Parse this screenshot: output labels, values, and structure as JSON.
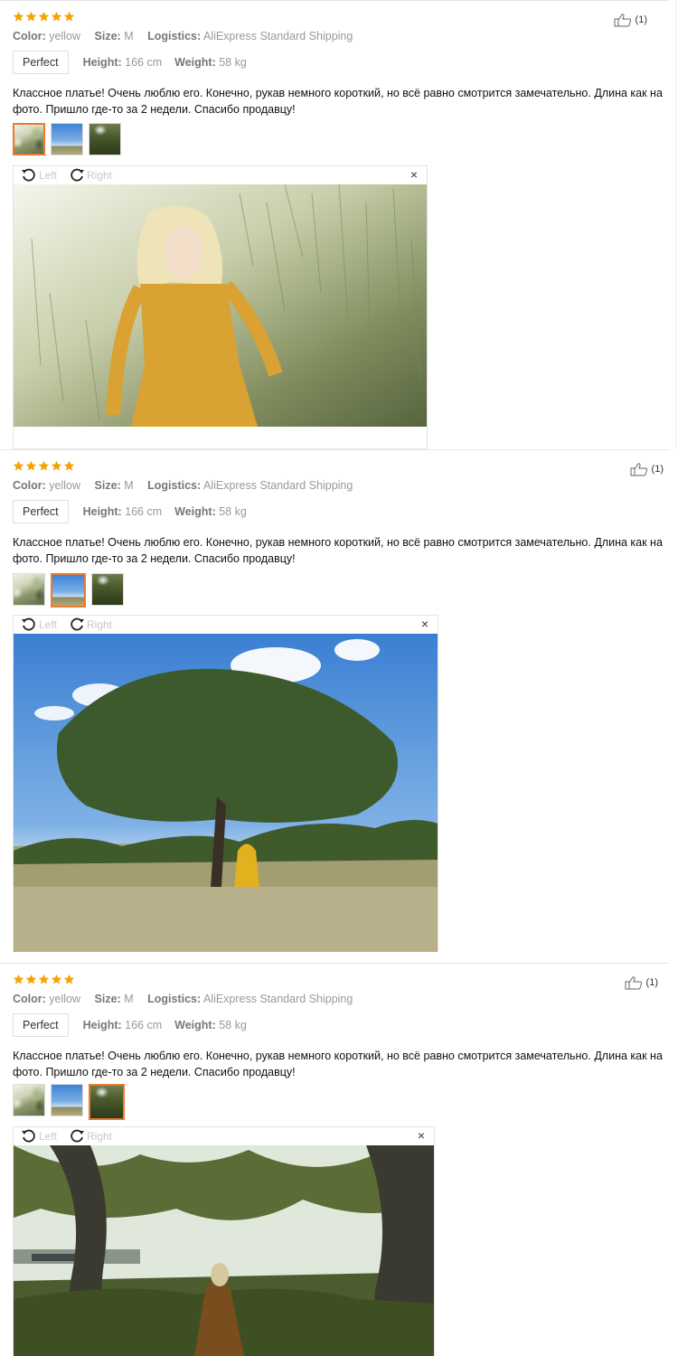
{
  "reviews": [
    {
      "stars": 5,
      "like_count": "1",
      "color_label": "Color:",
      "color_value": "yellow",
      "size_label": "Size:",
      "size_value": "M",
      "logistics_label": "Logistics:",
      "logistics_value": "AliExpress Standard Shipping",
      "fit": "Perfect",
      "height_label": "Height:",
      "height_value": "166 cm",
      "weight_label": "Weight:",
      "weight_value": "58 kg",
      "text": "Классное платье! Очень люблю его. Конечно, рукав немного короткий, но всё равно смотрится замечательно. Длина как на фото. Пришло где-то за 2 недели. Спасибо продавцу!",
      "active_thumb": 1,
      "rotate_left": "Left",
      "rotate_right": "Right",
      "close": "×"
    },
    {
      "stars": 5,
      "like_count": "1",
      "color_label": "Color:",
      "color_value": "yellow",
      "size_label": "Size:",
      "size_value": "M",
      "logistics_label": "Logistics:",
      "logistics_value": "AliExpress Standard Shipping",
      "fit": "Perfect",
      "height_label": "Height:",
      "height_value": "166 cm",
      "weight_label": "Weight:",
      "weight_value": "58 kg",
      "text": "Классное платье! Очень люблю его. Конечно, рукав немного короткий, но всё равно смотрится замечательно. Длина как на фото. Пришло где-то за 2 недели. Спасибо продавцу!",
      "active_thumb": 2,
      "rotate_left": "Left",
      "rotate_right": "Right",
      "close": "×"
    },
    {
      "stars": 5,
      "like_count": "1",
      "color_label": "Color:",
      "color_value": "yellow",
      "size_label": "Size:",
      "size_value": "M",
      "logistics_label": "Logistics:",
      "logistics_value": "AliExpress Standard Shipping",
      "fit": "Perfect",
      "height_label": "Height:",
      "height_value": "166 cm",
      "weight_label": "Weight:",
      "weight_value": "58 kg",
      "text": "Классное платье! Очень люблю его. Конечно, рукав немного короткий, но всё равно смотрится замечательно. Длина как на фото. Пришло где-то за 2 недели. Спасибо продавцу!",
      "active_thumb": 3,
      "rotate_left": "Left",
      "rotate_right": "Right",
      "close": "×"
    }
  ],
  "colors": {
    "star": "#f5a300",
    "accent": "#ee7a2f",
    "muted": "#999999"
  },
  "icons": {
    "star": "star-icon",
    "like": "thumbs-up-icon",
    "rotate_left": "rotate-left-icon",
    "rotate_right": "rotate-right-icon",
    "close": "close-icon"
  }
}
